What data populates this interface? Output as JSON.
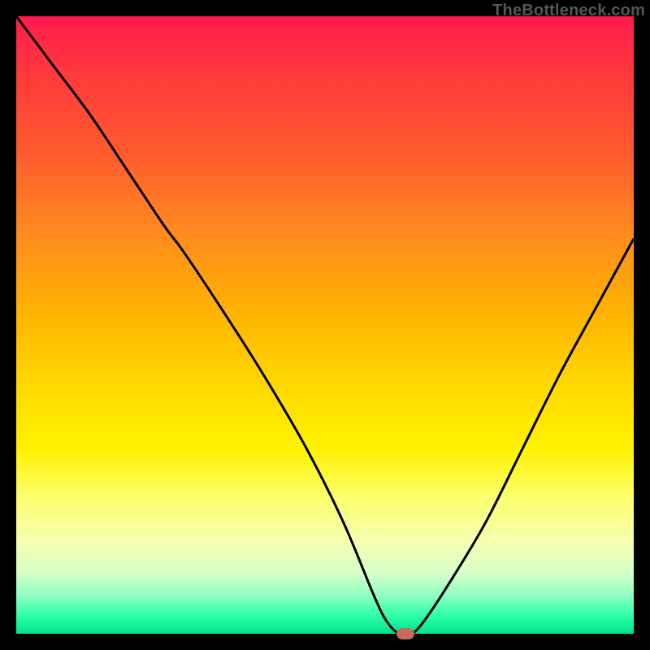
{
  "watermark": "TheBottleneck.com",
  "colors": {
    "page_bg": "#000000",
    "curve": "#000000",
    "marker": "#c86a5a"
  },
  "chart_data": {
    "type": "line",
    "title": "",
    "xlabel": "",
    "ylabel": "",
    "xlim": [
      0,
      100
    ],
    "ylim": [
      0,
      100
    ],
    "grid": false,
    "legend": false,
    "series": [
      {
        "name": "bottleneck-curve",
        "x": [
          0,
          6,
          12,
          18,
          24,
          27,
          33,
          40,
          47,
          53,
          58,
          60,
          62,
          64,
          66,
          70,
          76,
          82,
          88,
          94,
          100
        ],
        "y": [
          100,
          92,
          84,
          75,
          66,
          62,
          53,
          42,
          30,
          18,
          6,
          2,
          0,
          0,
          2,
          8,
          18,
          30,
          42,
          53,
          64
        ]
      }
    ],
    "marker": {
      "x": 63,
      "y": 0
    }
  }
}
